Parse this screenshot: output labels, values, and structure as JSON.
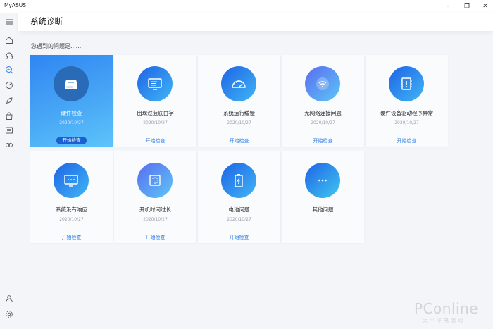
{
  "window": {
    "app_title": "MyASUS",
    "minimize_label": "–",
    "maximize_label": "❐",
    "close_label": "✕"
  },
  "sidebar": {
    "items": [
      {
        "icon": "menu-icon"
      },
      {
        "icon": "home-icon"
      },
      {
        "icon": "headset-icon"
      },
      {
        "icon": "diagnosis-icon",
        "active": true
      },
      {
        "icon": "speedometer-icon"
      },
      {
        "icon": "rocket-icon"
      },
      {
        "icon": "shopping-bag-icon"
      },
      {
        "icon": "news-icon"
      },
      {
        "icon": "link-icon"
      },
      {
        "icon": "user-icon"
      },
      {
        "icon": "gear-icon"
      }
    ],
    "accent_color": "#2f7fe8"
  },
  "header": {
    "title": "系统诊断"
  },
  "section_label": "您遇到的问题是......",
  "cards": [
    {
      "title": "硬件检查",
      "date": "2020/10/27",
      "action": "开始检查",
      "icon": "hardware-icon",
      "active": true
    },
    {
      "title": "出现过蓝底白字",
      "date": "2020/10/27",
      "action": "开始检查",
      "icon": "blue-screen-icon"
    },
    {
      "title": "系统运行缓慢",
      "date": "2020/10/27",
      "action": "开始检查",
      "icon": "gauge-icon"
    },
    {
      "title": "无网络连接问题",
      "date": "2020/10/27",
      "action": "开始检查",
      "icon": "wifi-icon"
    },
    {
      "title": "硬件设备驱动程序异常",
      "date": "2020/10/27",
      "action": "开始检查",
      "icon": "driver-icon"
    },
    {
      "title": "系统没有响应",
      "date": "2020/10/27",
      "action": "开始检查",
      "icon": "no-response-icon"
    },
    {
      "title": "开机时间过长",
      "date": "2020/10/27",
      "action": "开始检查",
      "icon": "boot-time-icon"
    },
    {
      "title": "电池问题",
      "date": "2020/10/27",
      "action": "开始检查",
      "icon": "battery-icon"
    },
    {
      "title": "其他问题",
      "date": "",
      "action": "",
      "icon": "more-icon"
    }
  ],
  "watermark": {
    "text": "PConline",
    "sub": "太平洋电脑网"
  }
}
